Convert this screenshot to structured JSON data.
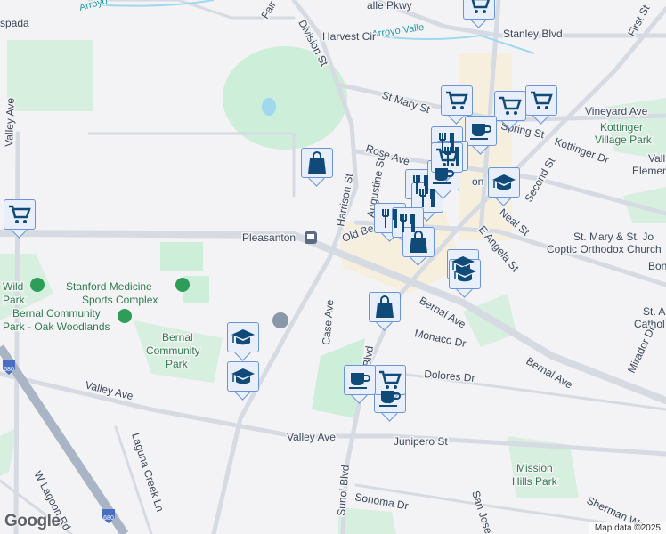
{
  "labels": {
    "arroyo": "Arroyo",
    "arroyo_valle": "Arroyo Valle",
    "valle_pkwy": "alle Pkwy",
    "harvest_cir": "Harvest Cir",
    "fair_st": "Fair St",
    "division_st": "Division St",
    "stanley_blvd": "Stanley Blvd",
    "first_st": "First St",
    "st_mary_st": "St Mary St",
    "vineyard_ave": "Vineyard Ave",
    "kottinger_park_1": "Kottinger",
    "kottinger_park_2": "Village Park",
    "kottinger_dr": "Kottinger Dr",
    "spring_st": "Spring St",
    "rose_ave": "Rose Ave",
    "valle_elem_1": "Vall",
    "valle_elem_2": "Elementary",
    "harrison_st": "Harrison St",
    "augustine_st": "Augustine St",
    "old_bernal": "Old Be",
    "pleasanton": "Pleasanton",
    "neal_st": "Neal St",
    "second_st": "Second St",
    "e_angela_st": "E Angela St",
    "coptic_1": "St. Mary & St. Jo",
    "coptic_2": "Coptic Orthodox Church",
    "bonde": "Bon",
    "st_aug_1": "St. A",
    "st_aug_2": "Cathol",
    "stanford_1": "Stanford Medicine",
    "stanford_2": "Sports Complex",
    "wild_1": "Wild",
    "wild_2": "Park",
    "bernal_oak_1": "Bernal Community",
    "bernal_oak_2": "Park - Oak Woodlands",
    "bernal_cp_1": "Bernal",
    "bernal_cp_2": "Community",
    "bernal_cp_3": "Park",
    "case_ave": "Case Ave",
    "bernal_ave_1": "Bernal Ave",
    "bernal_ave_2": "Bernal Ave",
    "monaco_dr": "Monaco Dr",
    "dolores_dr": "Dolores Dr",
    "sunol_blvd_1": "ol Blvd",
    "sunol_blvd_2": "Sunol Blvd",
    "valley_ave_1": "Valley Ave",
    "valley_ave_2": "Valley Ave",
    "valley_ave_3": "Valley Ave",
    "junipero_st": "Junipero St",
    "laguna_creek": "Laguna Creek Ln",
    "w_lagoon": "W Lagoon Rd",
    "mission_1": "Mission",
    "mission_2": "Hills Park",
    "sonoma_dr": "Sonoma Dr",
    "san_jose_dr": "San Jose Dr",
    "sherman": "Sherman Wa",
    "mirador_dr": "Mirador Dr",
    "espada": "spada",
    "ton": "on",
    "shield_1": "680",
    "shield_2": "680"
  },
  "markers": [
    "shopping-cart",
    "shopping-cart",
    "shopping-cart",
    "shopping-cart",
    "shopping-cart",
    "coffee",
    "restaurant",
    "restaurant",
    "restaurant",
    "restaurant",
    "restaurant",
    "restaurant",
    "shopping-bag",
    "shopping-bag",
    "shopping-bag",
    "school",
    "school",
    "school",
    "school",
    "school",
    "coffee",
    "coffee",
    "shopping-cart",
    "shopping-cart",
    "coffee"
  ],
  "footer": {
    "attribution": "Map data ©2025",
    "logo": "Google"
  }
}
